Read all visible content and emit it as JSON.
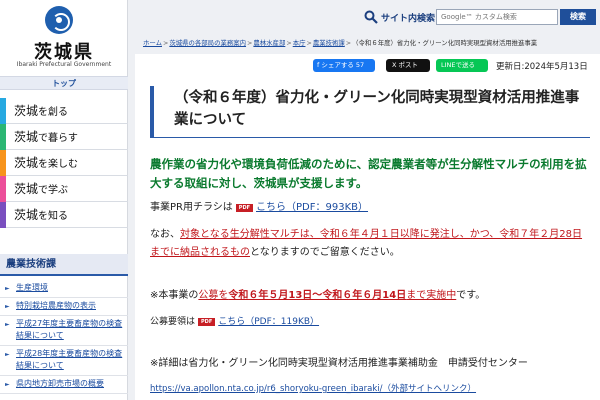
{
  "colors": {
    "brand_blue": "#1f4f9a",
    "lead_green": "#0a7a2e",
    "notice_red": "#c0161b",
    "menu_create": "#27a9e1",
    "menu_live": "#2bb673",
    "menu_enjoy": "#f7941d",
    "menu_learn": "#ec4f9a",
    "menu_know": "#7a4fbf"
  },
  "header": {
    "pref_name": "茨城県",
    "pref_name_en": "Ibaraki Prefectural Government",
    "top_link": "トップ",
    "search_label": "サイト内検索",
    "search_placeholder": "Google™ カスタム検索",
    "search_button": "検索",
    "logo_icon": "ibaraki-pref-logo"
  },
  "sidebar": {
    "menu": [
      {
        "prefix": "茨城",
        "suffix": "を創る"
      },
      {
        "prefix": "茨城",
        "suffix": "で暮らす"
      },
      {
        "prefix": "茨城",
        "suffix": "を楽しむ"
      },
      {
        "prefix": "茨城",
        "suffix": "で学ぶ"
      },
      {
        "prefix": "茨城",
        "suffix": "を知る"
      }
    ],
    "section_title": "農業技術課",
    "sub_items": [
      "生産環境",
      "特別栽培農産物の表示",
      "平成27年度主要畜産物の検査結果について",
      "平成28年度主要畜産物の検査結果について",
      "県内地方卸売市場の概要"
    ]
  },
  "breadcrumb": [
    "ホーム",
    "茨城県の各部局の業務案内",
    "農林水産部",
    "本庁",
    "農業技術課",
    "（令和６年度）省力化・グリーン化同時実現型資材活用推進事業"
  ],
  "share": {
    "facebook": "f シェアする 57",
    "x": "X ポスト",
    "line": "LINEで送る",
    "updated": "更新日:2024年5月13日"
  },
  "article": {
    "title": "（令和６年度）省力化・グリーン化同時実現型資材活用推進事業について",
    "lead": "農作業の省力化や環境負荷低減のために、認定農業者等が生分解性マルチの利用を拡大する取組に対し、茨城県が支援します。",
    "flyer_prefix": "事業PR用チラシは",
    "flyer_link": "こちら（PDF：993KB）",
    "pdf_badge": "PDF",
    "note_prefix": "なお、",
    "note_red": "対象となる生分解性マルチは、令和６年４月１日以降に発注し、かつ、令和７年２月28日までに納品されるもの",
    "note_suffix": "となりますのでご留意ください。",
    "period_prefix": "※本事業の",
    "period_red1": "公募を",
    "period_red_bold": "令和６年５月13日～令和６年６月14日",
    "period_red2": "まで実施中",
    "period_suffix": "です。",
    "guide_prefix": "公募要領は",
    "guide_link": "こちら（PDF：119KB）",
    "detail_text": "※詳細は省力化・グリーン化同時実現型資材活用推進事業補助金　申請受付センター",
    "detail_url": "https://va.apollon.nta.co.jp/r6_shoryoku-green_ibaraki/（外部サイトへリンク）"
  }
}
